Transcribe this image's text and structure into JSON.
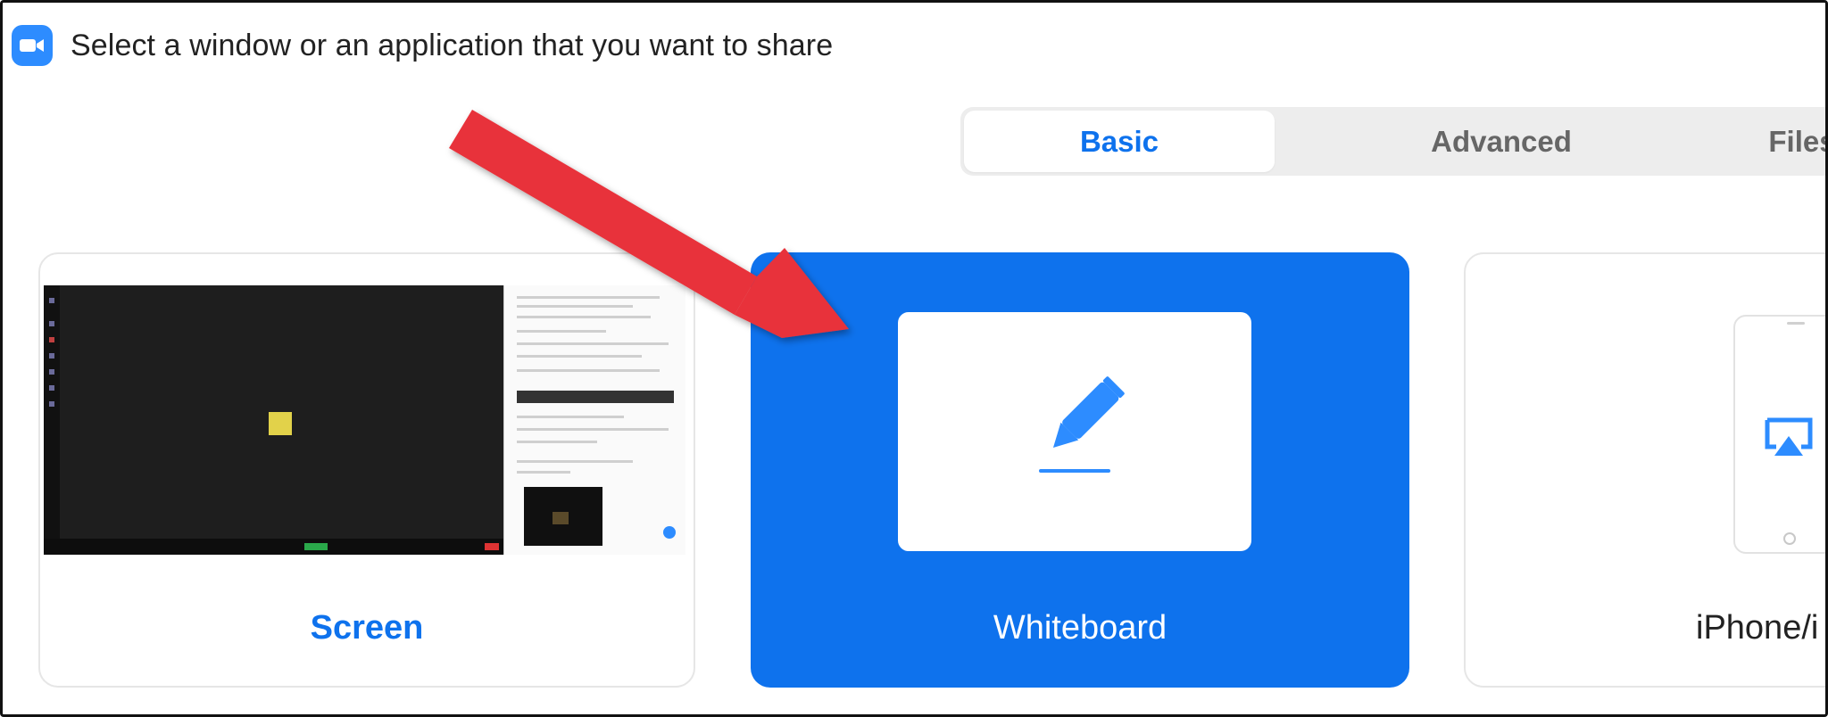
{
  "window": {
    "title": "Select a window or an application that you want to share",
    "app_icon": "zoom-camera-icon"
  },
  "tabs": [
    {
      "label": "Basic",
      "active": true
    },
    {
      "label": "Advanced",
      "active": false
    },
    {
      "label": "Files",
      "active": false
    }
  ],
  "cards": {
    "screen": {
      "label": "Screen",
      "thumbnail_icon": "desktop-screenshot"
    },
    "whiteboard": {
      "label": "Whiteboard",
      "icon": "pencil-icon",
      "selected": true
    },
    "iphone": {
      "label": "iPhone/i",
      "icon": "airplay-icon"
    }
  },
  "annotation": {
    "arrow_color": "#e8333a",
    "icon": "red-arrow"
  },
  "colors": {
    "accent": "#0e72ed",
    "brand": "#2d8cff"
  }
}
